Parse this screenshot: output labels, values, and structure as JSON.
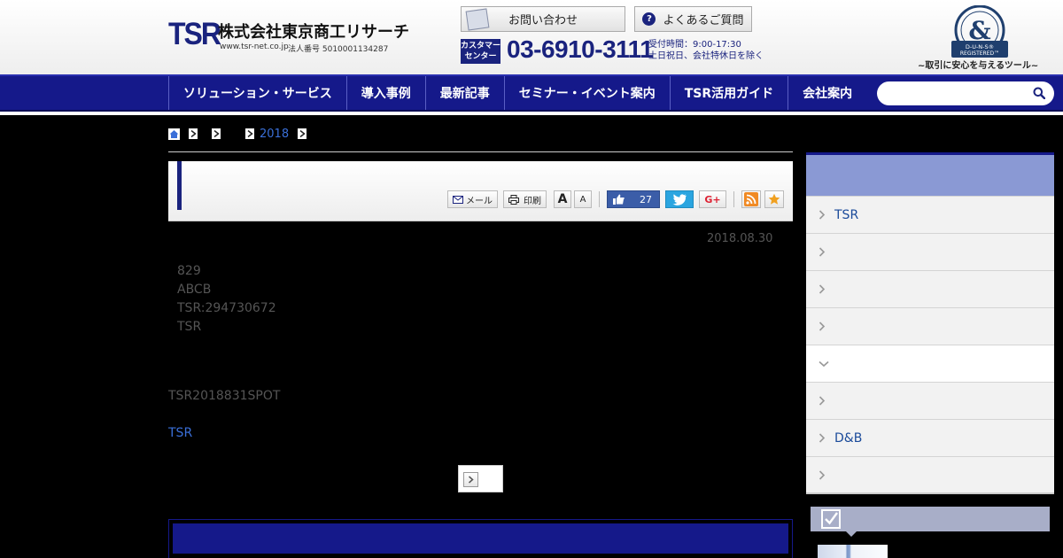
{
  "header": {
    "logo_mark": "TSR",
    "company_name": "株式会社東京商工リサーチ",
    "site_url": "www.tsr-net.co.jp",
    "corporate_number": "法人番号 5010001134287",
    "contact_label": "お問い合わせ",
    "faq_label": "よくあるご質問",
    "faq_icon_glyph": "?",
    "customer_center_label": "カスタマーセンター",
    "customer_center_label_line1": "カスタマー",
    "customer_center_label_line2": "センター",
    "phone": "03-6910-3111",
    "hours": "受付時間：9:00-17:30",
    "holidays": "土日祝日、会社特休日を除く",
    "duns_text": "D-U-N-S® REGISTERED™",
    "duns_tagline": "~取引に安心を与えるツール~",
    "accent_color": "#1a237e"
  },
  "nav": {
    "items": [
      {
        "label": "ソリューション・サービス"
      },
      {
        "label": "導入事例"
      },
      {
        "label": "最新記事"
      },
      {
        "label": "セミナー・イベント案内"
      },
      {
        "label": "TSR活用ガイド"
      },
      {
        "label": "会社案内"
      }
    ],
    "search_placeholder": "",
    "bar_color": "#15198a"
  },
  "breadcrumb": {
    "year": "2018"
  },
  "article": {
    "tools": {
      "mail_label": "メール",
      "print_label": "印刷",
      "font_large": "A",
      "font_small": "A",
      "like_count": "27",
      "gplus_label": "G+"
    },
    "date": "2018.08.30",
    "lines": [
      "829",
      "ABCB",
      "TSR:294730672",
      "TSR"
    ],
    "note": "TSR2018831SPOT",
    "link_label": "TSR"
  },
  "sidebar": {
    "items": [
      {
        "label": "TSR",
        "active": false
      },
      {
        "label": "",
        "active": false
      },
      {
        "label": "",
        "active": false
      },
      {
        "label": "",
        "active": false
      },
      {
        "label": "",
        "active": true
      },
      {
        "label": "",
        "active": false
      },
      {
        "label": "D&B",
        "active": false
      },
      {
        "label": "",
        "active": false
      }
    ]
  }
}
